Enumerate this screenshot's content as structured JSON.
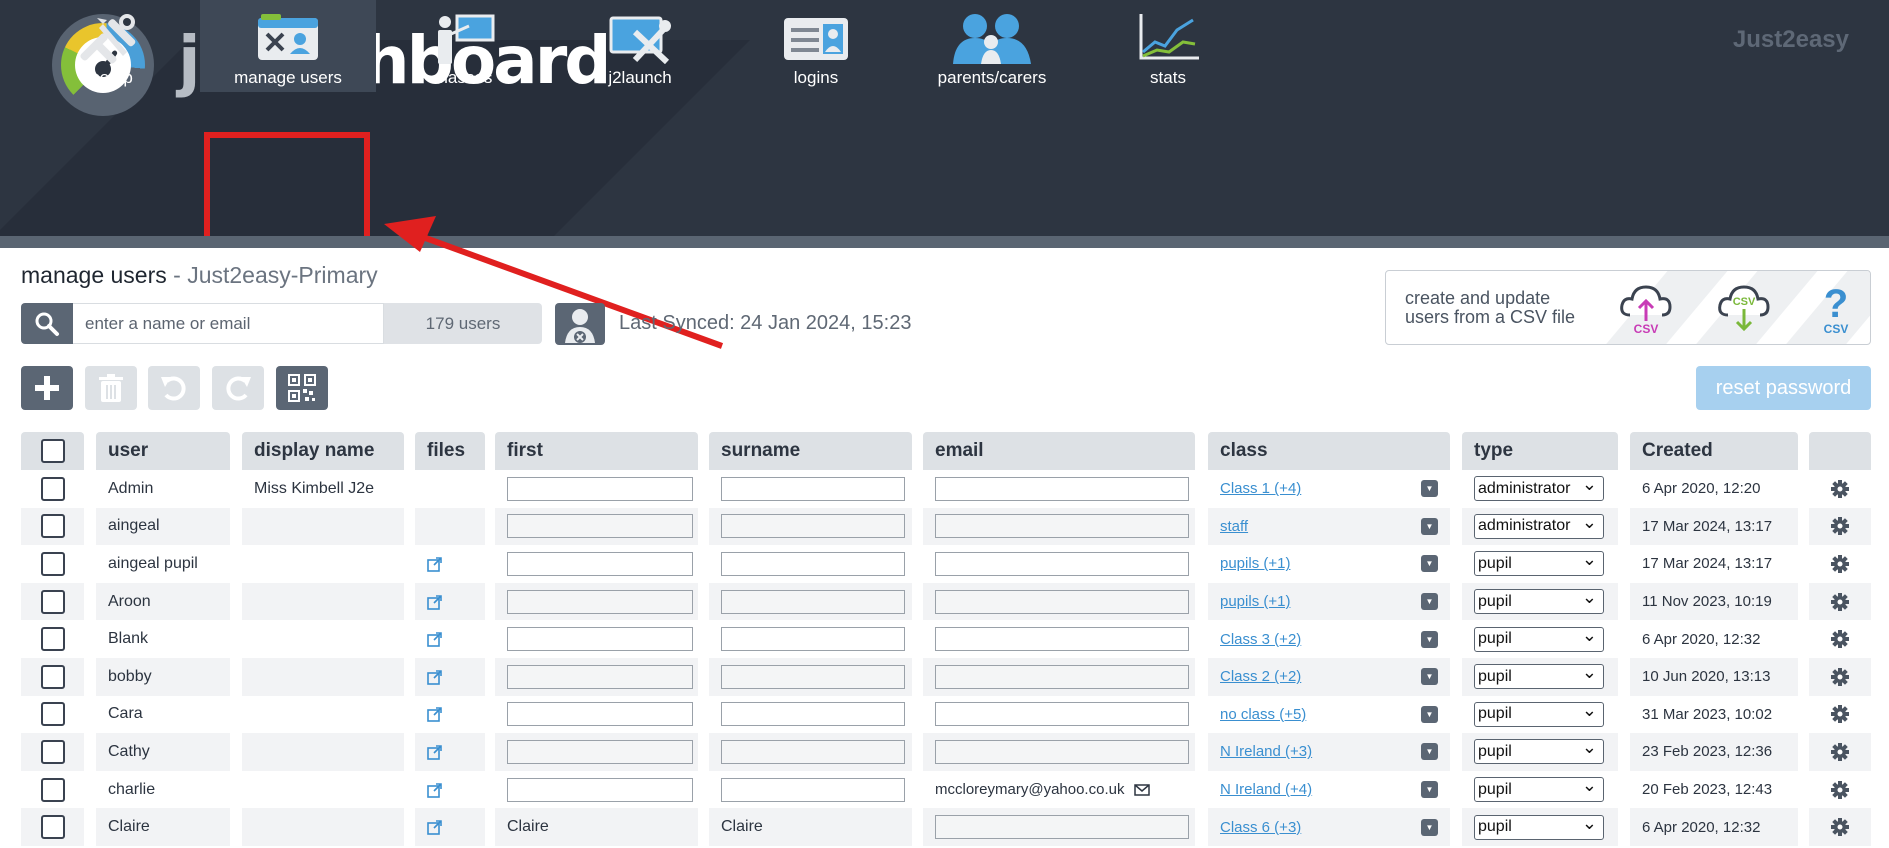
{
  "header": {
    "brand_prefix": "j2",
    "brand_suffix": "dashboard",
    "site": "Just2easy"
  },
  "nav": [
    {
      "label": "setup",
      "icon": "tools-icon"
    },
    {
      "label": "manage users",
      "icon": "id-card-icon",
      "active": true
    },
    {
      "label": "classes",
      "icon": "teacher-board-icon"
    },
    {
      "label": "j2launch",
      "icon": "launch-tools-icon"
    },
    {
      "label": "logins",
      "icon": "login-card-icon"
    },
    {
      "label": "parents/carers",
      "icon": "parents-icon"
    },
    {
      "label": "stats",
      "icon": "line-chart-icon"
    }
  ],
  "page": {
    "title": "manage users",
    "separator": " - ",
    "school": "Just2easy-Primary"
  },
  "search": {
    "placeholder": "enter a name or email",
    "count": "179 users"
  },
  "sync": {
    "text": "Last Synced: 24 Jan 2024, 15:23"
  },
  "csv": {
    "line1": "create and update",
    "line2": "users from a CSV file",
    "icons": [
      "csv-upload-icon",
      "csv-download-icon",
      "csv-help-icon"
    ]
  },
  "toolbar": {
    "reset_password": "reset password"
  },
  "table": {
    "headers": [
      "user",
      "display name",
      "files",
      "first",
      "surname",
      "email",
      "class",
      "type",
      "Created"
    ],
    "rows": [
      {
        "user": "Admin",
        "display": "Miss Kimbell J2e",
        "files": false,
        "first": "",
        "surname": "",
        "email": "",
        "class": "Class 1 (+4)",
        "type": "administrator",
        "created": "6 Apr 2020, 12:20"
      },
      {
        "user": "aingeal",
        "display": "",
        "files": false,
        "first": "",
        "surname": "",
        "email": "",
        "class": "staff",
        "type": "administrator",
        "created": "17 Mar 2024, 13:17"
      },
      {
        "user": "aingeal pupil",
        "display": "",
        "files": true,
        "first": "",
        "surname": "",
        "email": "",
        "class": "pupils (+1)",
        "type": "pupil",
        "created": "17 Mar 2024, 13:17"
      },
      {
        "user": "Aroon",
        "display": "",
        "files": true,
        "first": "",
        "surname": "",
        "email": "",
        "class": "pupils (+1)",
        "type": "pupil",
        "created": "11 Nov 2023, 10:19"
      },
      {
        "user": "Blank",
        "display": "",
        "files": true,
        "first": "",
        "surname": "",
        "email": "",
        "class": "Class 3 (+2)",
        "type": "pupil",
        "created": "6 Apr 2020, 12:32"
      },
      {
        "user": "bobby",
        "display": "",
        "files": true,
        "first": "",
        "surname": "",
        "email": "",
        "class": "Class 2 (+2)",
        "type": "pupil",
        "created": "10 Jun 2020, 13:13"
      },
      {
        "user": "Cara",
        "display": "",
        "files": true,
        "first": "",
        "surname": "",
        "email": "",
        "class": "no class (+5)",
        "type": "pupil",
        "created": "31 Mar 2023, 10:02"
      },
      {
        "user": "Cathy",
        "display": "",
        "files": true,
        "first": "",
        "surname": "",
        "email": "",
        "class": "N Ireland (+3)",
        "type": "pupil",
        "created": "23 Feb 2023, 12:36"
      },
      {
        "user": "charlie",
        "display": "",
        "files": true,
        "first": "",
        "surname": "",
        "email": "mccloreymary@yahoo.co.uk",
        "class": "N Ireland (+4)",
        "type": "pupil",
        "created": "20 Feb 2023, 12:43"
      },
      {
        "user": "Claire",
        "display": "",
        "files": true,
        "first": "Claire",
        "surname": "Claire",
        "email": "",
        "class": "Class 6 (+3)",
        "type": "pupil",
        "created": "6 Apr 2020, 12:32"
      }
    ]
  },
  "colors": {
    "header_bg": "#2d3541",
    "accent_red": "#e0201f",
    "link_blue": "#3a8fd0"
  }
}
